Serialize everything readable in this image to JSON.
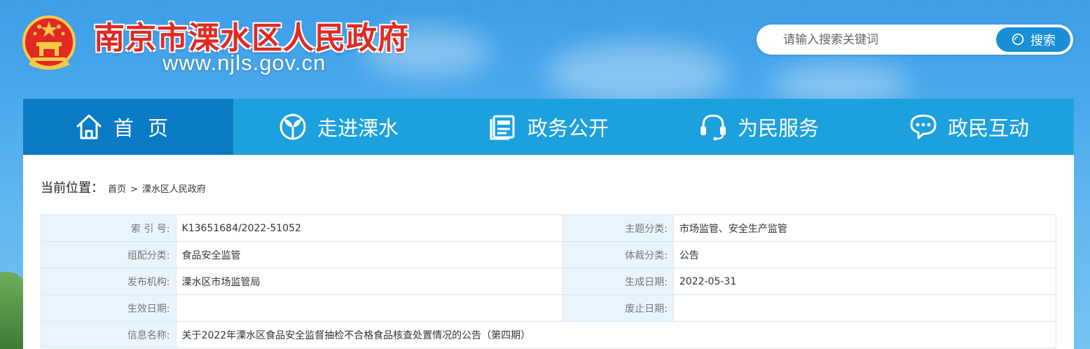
{
  "header": {
    "title": "南京市溧水区人民政府",
    "url": "www.njls.gov.cn"
  },
  "search": {
    "placeholder": "请输入搜索关键词",
    "button_label": "搜索"
  },
  "nav": {
    "items": [
      {
        "label": "首页",
        "icon": "home-icon",
        "active": true
      },
      {
        "label": "走进溧水",
        "icon": "leaf-icon"
      },
      {
        "label": "政务公开",
        "icon": "document-icon"
      },
      {
        "label": "为民服务",
        "icon": "headset-icon"
      },
      {
        "label": "政民互动",
        "icon": "chat-icon"
      }
    ]
  },
  "breadcrumb": {
    "label": "当前位置：",
    "items": [
      "首页",
      "溧水区人民政府"
    ],
    "separator": ">"
  },
  "info_table": {
    "index_no": {
      "label": "索 引 号:",
      "value": "K13651684/2022-51052"
    },
    "topic": {
      "label": "主题分类:",
      "value": "市场监管、安全生产监管"
    },
    "org_category": {
      "label": "组配分类:",
      "value": "食品安全监管"
    },
    "genre": {
      "label": "体裁分类:",
      "value": "公告"
    },
    "publisher": {
      "label": "发布机构:",
      "value": "溧水区市场监管局"
    },
    "created": {
      "label": "生成日期:",
      "value": "2022-05-31"
    },
    "effective": {
      "label": "生效日期:",
      "value": ""
    },
    "expired": {
      "label": "废止日期:",
      "value": ""
    },
    "name": {
      "label": "信息名称:",
      "value": "关于2022年溧水区食品安全监督抽检不合格食品核查处置情况的公告（第四期）"
    }
  },
  "colors": {
    "nav_bg": "#1ca1de",
    "nav_active": "#0a7bc4",
    "title_red": "#e02a23",
    "label_bg": "#eaf4fc"
  }
}
